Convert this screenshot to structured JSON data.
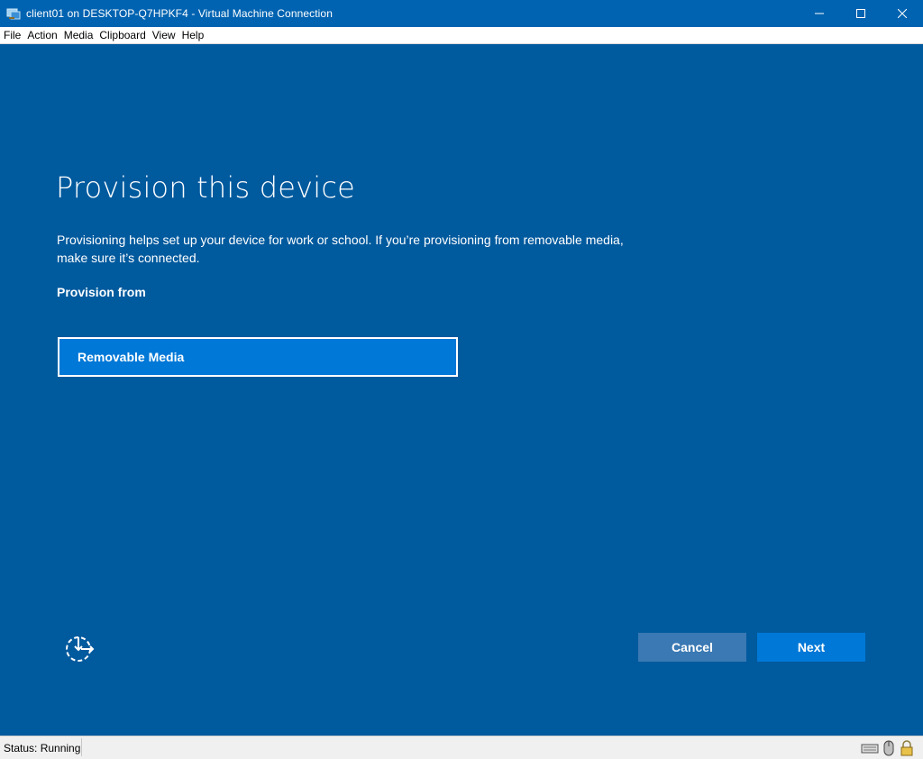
{
  "window": {
    "title": "client01 on DESKTOP-Q7HPKF4 - Virtual Machine Connection",
    "icon": "vm-connection-icon",
    "controls": [
      "minimize-icon",
      "maximize-icon",
      "close-icon"
    ]
  },
  "menubar": {
    "items": [
      "File",
      "Action",
      "Media",
      "Clipboard",
      "View",
      "Help"
    ]
  },
  "page": {
    "title": "Provision this device",
    "description": "Provisioning helps set up your device for work or school. If you’re provisioning from removable media, make sure it’s connected.",
    "provision_from_label": "Provision from",
    "option_label": "Removable Media",
    "accessibility_icon": "ease-of-access-icon"
  },
  "buttons": {
    "cancel": "Cancel",
    "next": "Next"
  },
  "statusbar": {
    "status": "Status: Running",
    "icons": [
      "keyboard-icon",
      "mouse-icon",
      "lock-icon"
    ]
  },
  "colors": {
    "background": "#005a9e",
    "titlebar": "#0063b1",
    "accent": "#0078d7",
    "cancel_button": "#3a79b3"
  }
}
